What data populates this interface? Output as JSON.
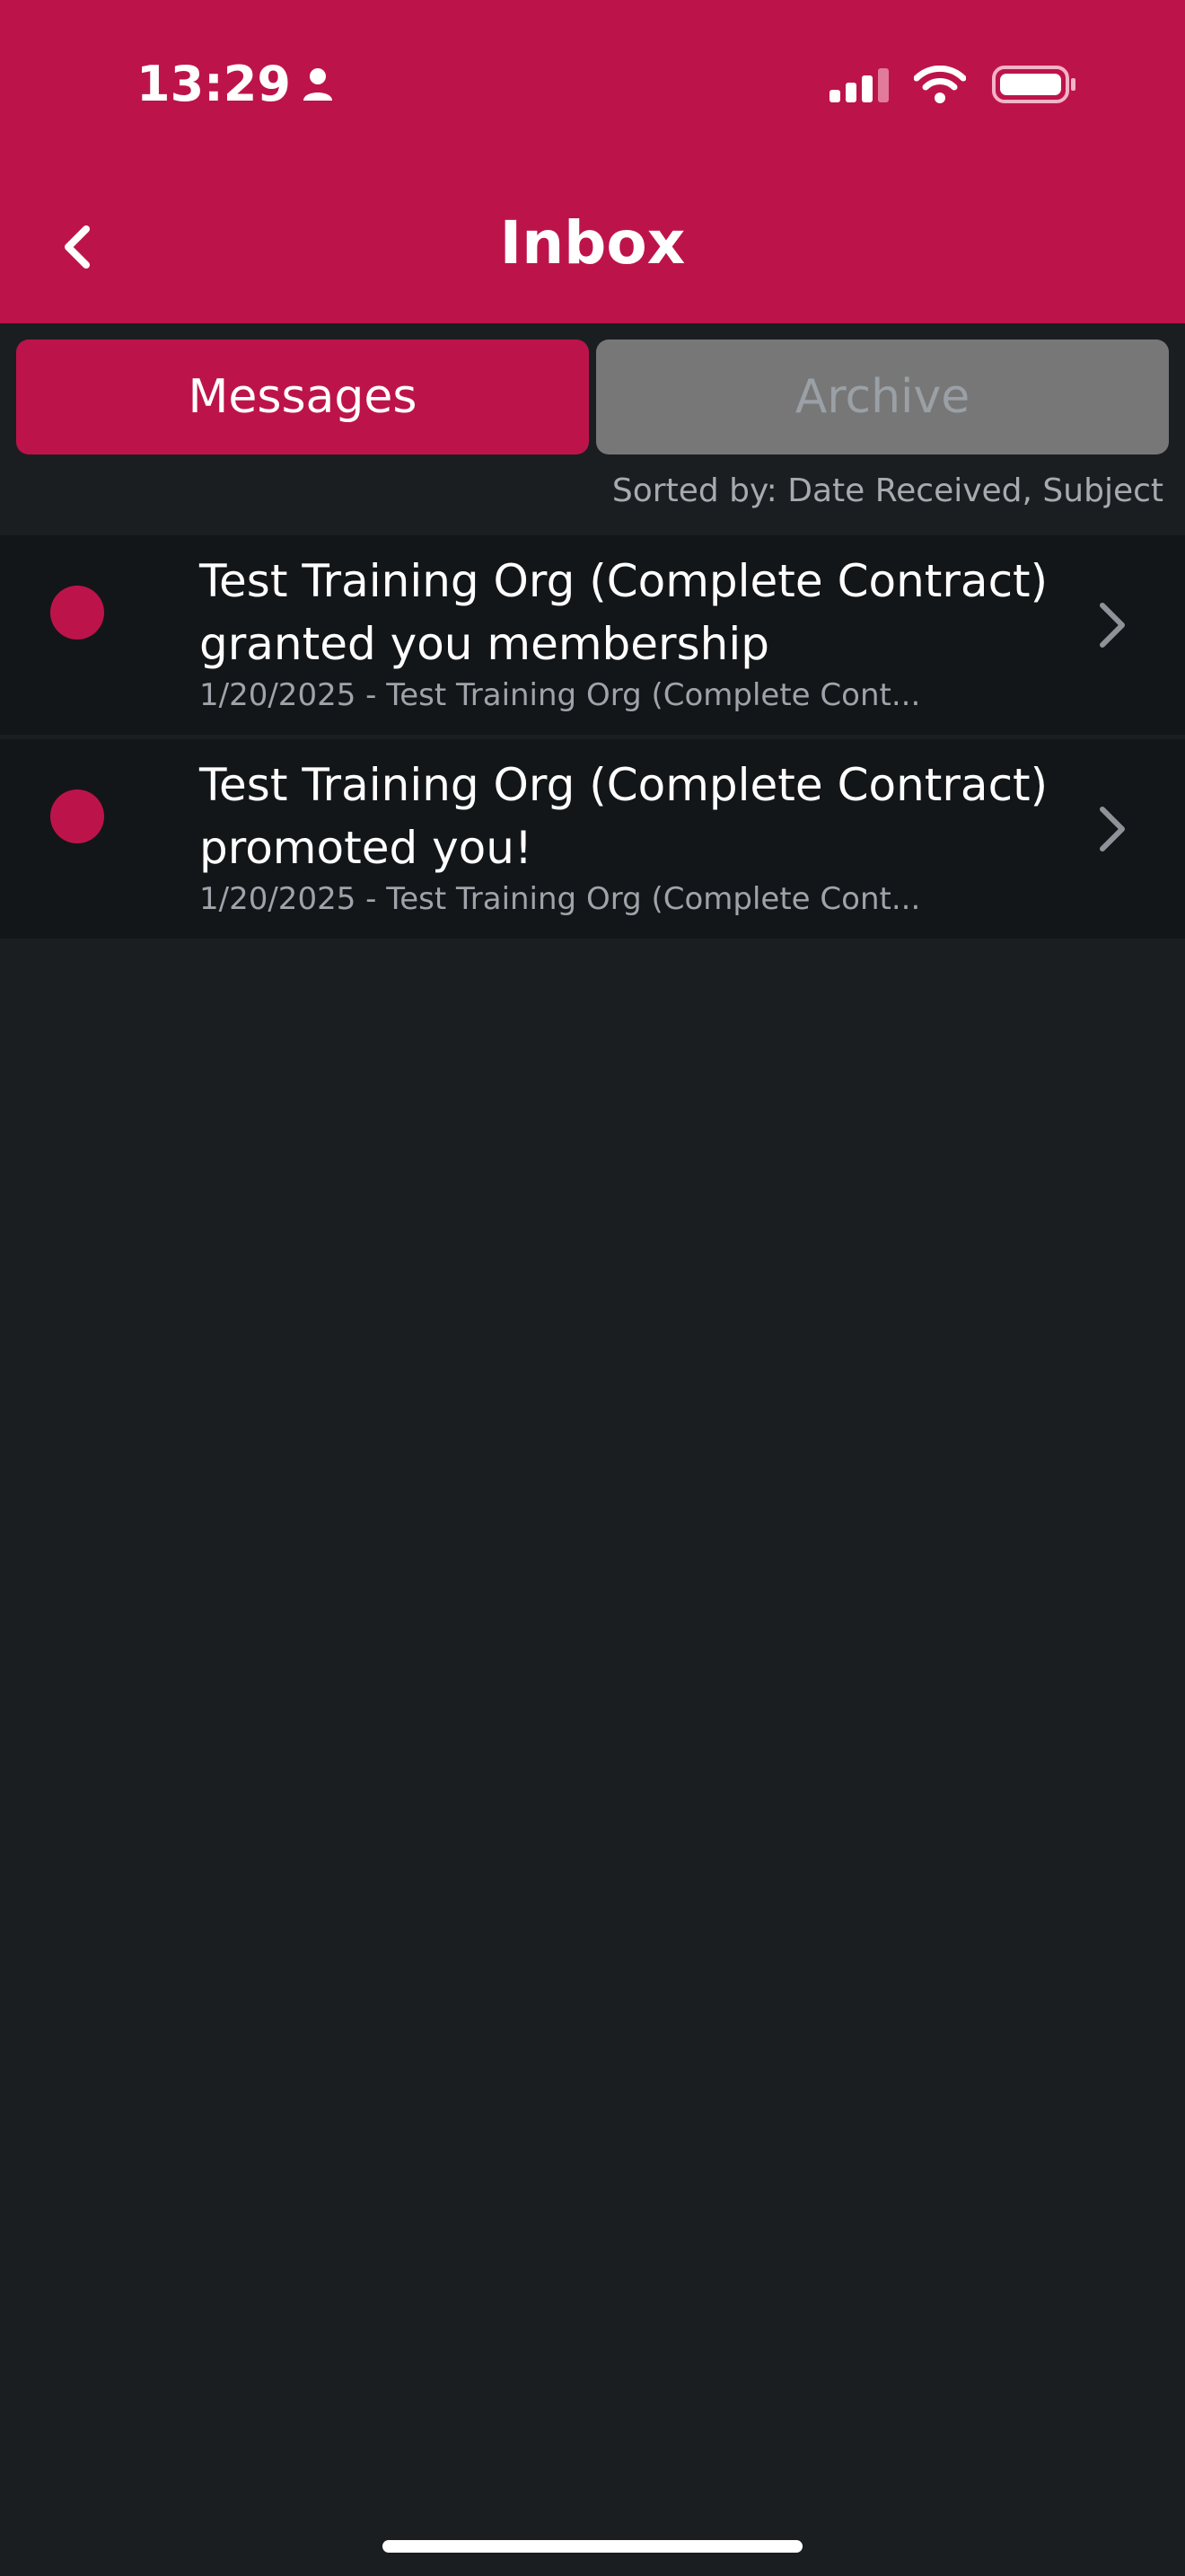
{
  "status_bar": {
    "time": "13:29",
    "person_icon": "person-icon",
    "signal_icon": "cellular-signal-icon",
    "wifi_icon": "wifi-icon",
    "battery_icon": "battery-icon"
  },
  "header": {
    "title": "Inbox",
    "back_icon": "chevron-left-icon"
  },
  "tabs": [
    {
      "label": "Messages",
      "active": true
    },
    {
      "label": "Archive",
      "active": false
    }
  ],
  "sort_label": "Sorted by: Date Received, Subject",
  "messages": [
    {
      "subject": "Test Training Org (Complete Contract) granted you membership",
      "preview": "1/20/2025 - Test Training Org (Complete Cont...",
      "unread": true
    },
    {
      "subject": "Test Training Org (Complete Contract) promoted you!",
      "preview": "1/20/2025 - Test Training Org (Complete Cont...",
      "unread": true
    }
  ],
  "colors": {
    "accent": "#bd134b",
    "background": "#1b1e21",
    "row_background": "#131618",
    "inactive_tab": "#777777"
  }
}
